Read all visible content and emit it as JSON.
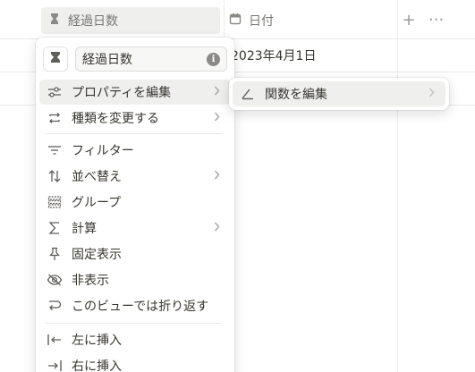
{
  "header": {
    "columns": [
      {
        "label": "経過日数",
        "icon": "hourglass-icon"
      },
      {
        "label": "日付",
        "icon": "calendar-icon"
      }
    ],
    "add_label": "+",
    "more_label": "···"
  },
  "rows": [
    {
      "date": "2023年4月1日"
    },
    {
      "date": ""
    }
  ],
  "menu": {
    "name_value": "経過日数",
    "info_label": "i",
    "items": [
      {
        "label": "プロパティを編集",
        "icon": "sliders-icon",
        "has_submenu": true
      },
      {
        "label": "種類を変更する",
        "icon": "convert-icon",
        "has_submenu": true
      },
      {
        "label": "フィルター",
        "icon": "filter-icon",
        "has_submenu": false
      },
      {
        "label": "並べ替え",
        "icon": "sort-icon",
        "has_submenu": true
      },
      {
        "label": "グループ",
        "icon": "group-icon",
        "has_submenu": false
      },
      {
        "label": "計算",
        "icon": "sigma-icon",
        "has_submenu": true
      },
      {
        "label": "固定表示",
        "icon": "pin-icon",
        "has_submenu": false
      },
      {
        "label": "非表示",
        "icon": "eye-off-icon",
        "has_submenu": false
      },
      {
        "label": "このビューでは折り返す",
        "icon": "wrap-icon",
        "has_submenu": false
      },
      {
        "label": "左に挿入",
        "icon": "insert-left-icon",
        "has_submenu": false
      },
      {
        "label": "右に挿入",
        "icon": "insert-right-icon",
        "has_submenu": false
      }
    ]
  },
  "submenu": {
    "items": [
      {
        "label": "関数を編集",
        "icon": "formula-icon",
        "has_submenu": true
      }
    ]
  }
}
